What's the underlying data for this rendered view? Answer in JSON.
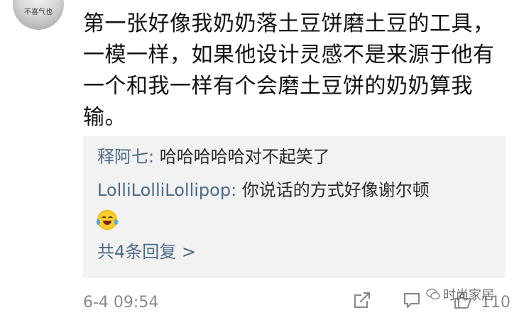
{
  "avatar": {
    "text": "不喜气也"
  },
  "comment": {
    "text": "第一张好像我奶奶落土豆饼磨土豆的工具，一模一样，如果他设计灵感不是来源于他有一个和我一样有个会磨土豆饼的奶奶算我输。"
  },
  "replies": [
    {
      "name": "释阿七",
      "separator": ": ",
      "text": "哈哈哈哈哈对不起笑了"
    },
    {
      "name": "LolliLolliLollipop",
      "separator": ": ",
      "text": "你说话的方式好像谢尔顿"
    }
  ],
  "more_replies": "共4条回复 >",
  "footer": {
    "time": "6-4 09:54",
    "like_count": "110"
  },
  "watermark": {
    "text": "时尚家居"
  },
  "icons": {
    "share": "share-icon",
    "comment": "comment-icon",
    "like": "like-icon",
    "emoji": "laugh-cry-emoji-icon",
    "watermark": "wechat-logo-icon"
  }
}
